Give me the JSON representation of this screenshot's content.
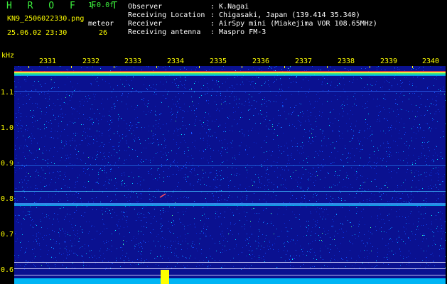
{
  "header": {
    "app_title": "H R O F F T",
    "version": "1.0.0f",
    "filename": "KN9_2506022330.png",
    "mode_label": "meteor",
    "timestamp": "25.06.02 23:30",
    "count": "26"
  },
  "station_info": [
    {
      "label": "Observer",
      "value": ": K.Nagai"
    },
    {
      "label": "Receiving Location",
      "value": ": Chigasaki, Japan (139.414 35.340)"
    },
    {
      "label": "Receiver",
      "value": ": AirSpy mini (Miakejima VOR 108.65MHz)"
    },
    {
      "label": "Receiving antenna",
      "value": ": Maspro FM-3"
    }
  ],
  "axes": {
    "unit_label": "kHz",
    "y_ticks": [
      "1.1",
      "1.0",
      "0.9",
      "0.8",
      "0.7",
      "0.6"
    ],
    "x_ticks": [
      "2331",
      "2332",
      "2333",
      "2334",
      "2335",
      "2336",
      "2337",
      "2338",
      "2339",
      "2340"
    ]
  },
  "colors": {
    "background": "#000000",
    "plot_background": "#0a1190",
    "header_green": "#3cf03c",
    "label_yellow": "#ffff00",
    "text_white": "#ffffff",
    "noise_cyan": "#00ffff"
  }
}
